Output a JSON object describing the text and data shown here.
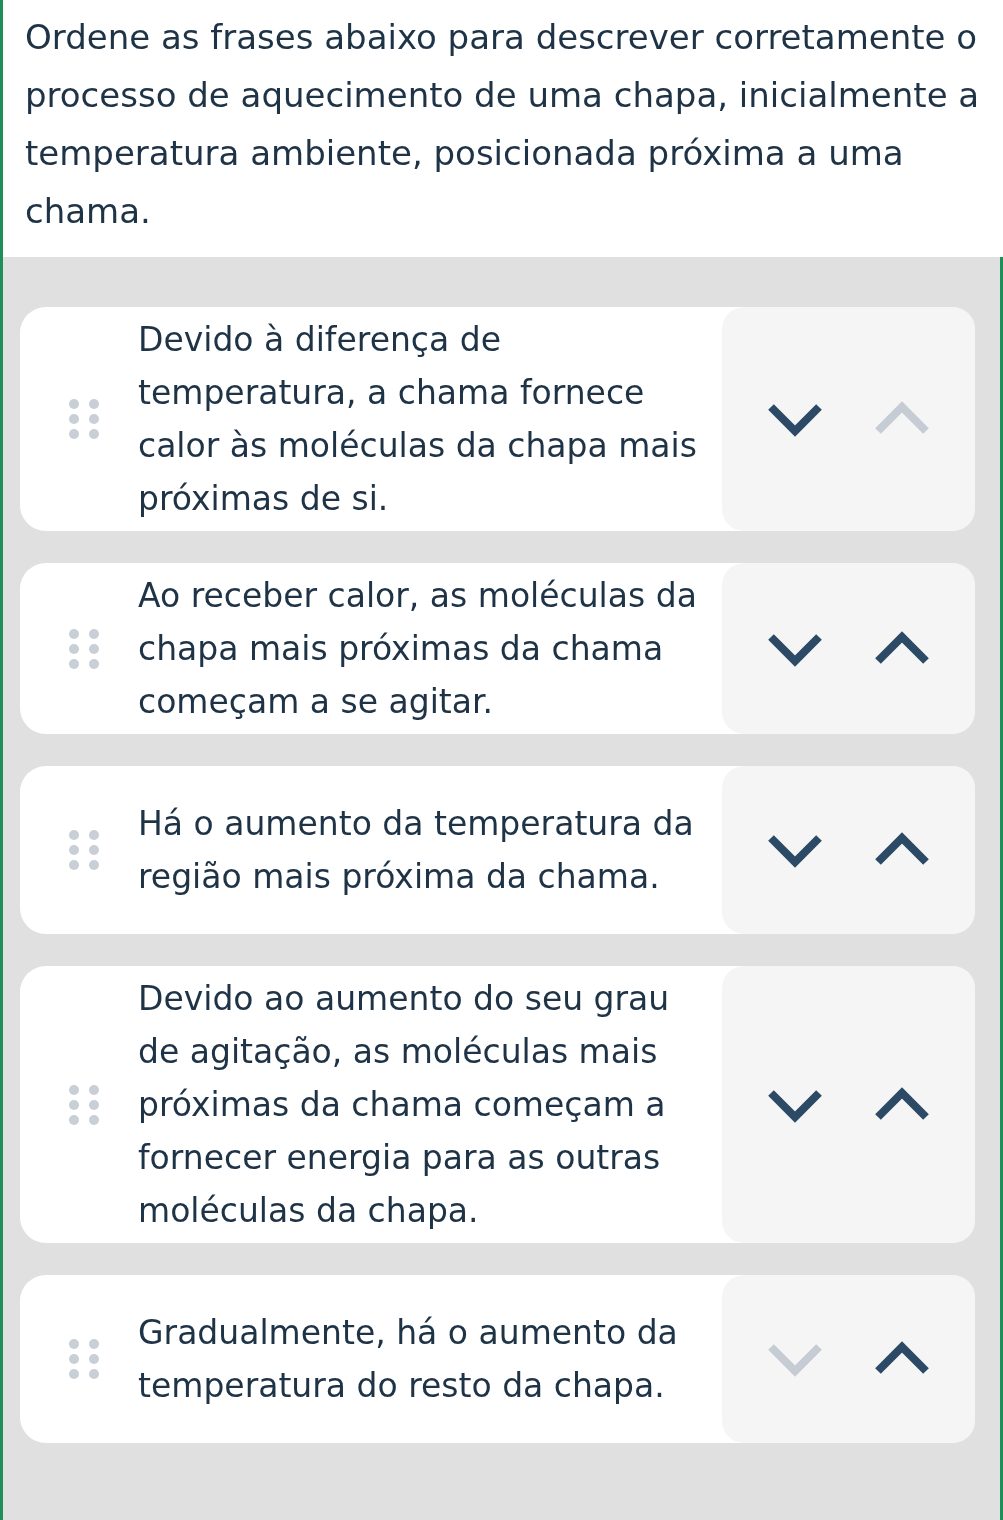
{
  "question": "Ordene as frases abaixo para descrever corretamente o processo de aquecimento de uma chapa, inicialmente a temperatura ambiente, posicionada próxima a uma chama.",
  "items": [
    {
      "text": "Devido à diferença de temperatura, a chama fornece calor às moléculas da chapa mais próximas de si.",
      "down_disabled": false,
      "up_disabled": true
    },
    {
      "text": "Ao receber calor, as moléculas da chapa mais próximas da chama começam a se agitar.",
      "down_disabled": false,
      "up_disabled": false
    },
    {
      "text": "Há o aumento da temperatura da região mais próxima da chama.",
      "down_disabled": false,
      "up_disabled": false
    },
    {
      "text": "Devido ao aumento do seu grau de agitação, as moléculas mais próximas da chama começam a fornecer energia para as outras moléculas da chapa.",
      "down_disabled": false,
      "up_disabled": false
    },
    {
      "text": "Gradualmente, há o aumento da temperatura do resto da chapa.",
      "down_disabled": true,
      "up_disabled": false
    }
  ]
}
